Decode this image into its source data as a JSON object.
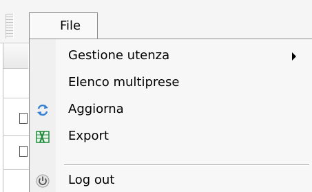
{
  "menubar": {
    "file_label": "File"
  },
  "file_menu": {
    "items": [
      {
        "label": "Gestione utenza",
        "icon": "none",
        "has_submenu": true
      },
      {
        "label": "Elenco multiprese",
        "icon": "none",
        "has_submenu": false
      },
      {
        "label": "Aggiorna",
        "icon": "refresh-icon",
        "has_submenu": false
      },
      {
        "label": "Export",
        "icon": "excel-icon",
        "has_submenu": false
      },
      {
        "label": "Log out",
        "icon": "power-icon",
        "has_submenu": false
      }
    ]
  },
  "colors": {
    "menu_background": "#f7f7f7",
    "menu_border": "#8a8a8a",
    "refresh_blue": "#2f7fd4",
    "excel_green": "#1f8a3a"
  }
}
